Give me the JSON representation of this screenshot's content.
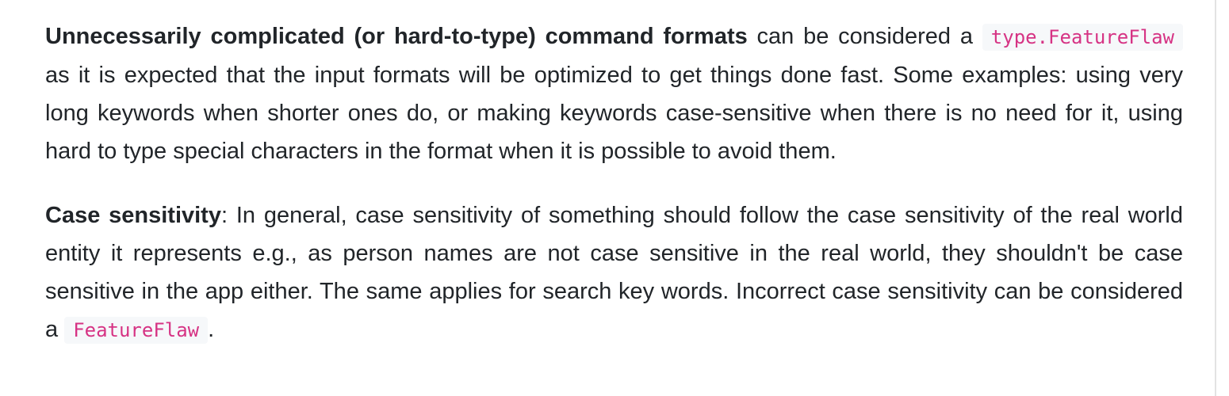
{
  "paragraph1": {
    "bold_lead": "Unnecessarily complicated (or hard-to-type) command formats",
    "text_before_code": " can be considered a ",
    "code": "type.FeatureFlaw",
    "text_after_code": " as it is expected that the input formats will be optimized to get things done fast. Some examples: using very long keywords when shorter ones do, or making keywords case-sensitive when there is no need for it, using hard to type special characters in the format when it is possible to avoid them."
  },
  "paragraph2": {
    "bold_lead": "Case sensitivity",
    "text_before_code": ": In general, case sensitivity of something should follow the case sensitivity of the real world entity it represents e.g., as person names are not case sensitive in the real world, they shouldn't be case sensitive in the app either. The same applies for search key words. Incorrect case sensitivity can be considered a ",
    "code": "FeatureFlaw",
    "text_after_code": "."
  }
}
